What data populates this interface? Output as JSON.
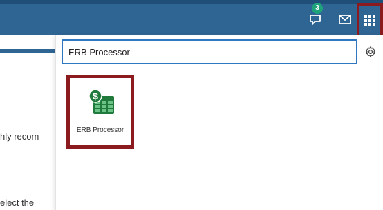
{
  "header": {
    "notification_count": "3",
    "icons": [
      "chat-icon",
      "mail-icon",
      "app-grid-icon"
    ]
  },
  "background_page": {
    "text_1": "hly recom",
    "text_2": "elect the"
  },
  "app_launcher": {
    "search_value": "ERB Processor",
    "settings_icon": "gear-icon",
    "tiles": [
      {
        "label": "ERB Processor",
        "icon": "dollar-spreadsheet-icon"
      }
    ]
  },
  "colors": {
    "header": "#2f6593",
    "highlight_border": "#8b1b1f",
    "badge": "#1fa37a",
    "search_border": "#2f78bf",
    "app_icon_green": "#1f7a3c"
  }
}
